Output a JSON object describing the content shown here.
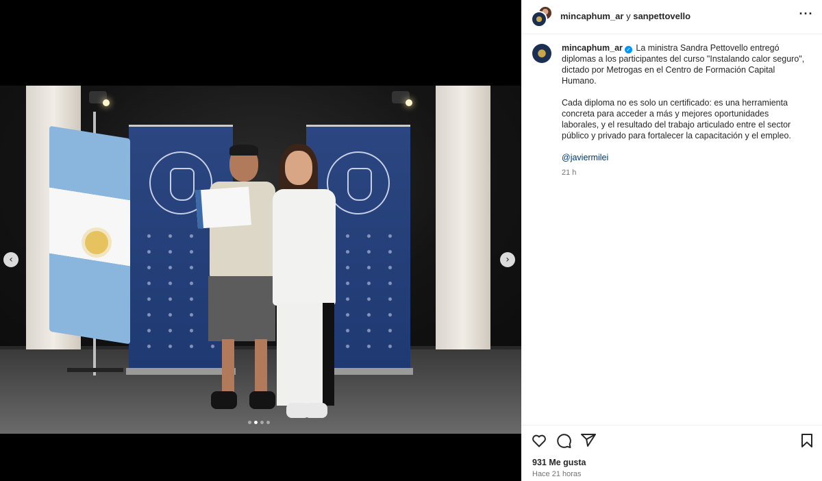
{
  "header": {
    "user1": "mincaphum_ar",
    "joiner": " y ",
    "user2": "sanpettovello",
    "more_icon": "more-horizontal-icon"
  },
  "caption": {
    "username": "mincaphum_ar",
    "verified_icon": "verified-badge-icon",
    "paragraph1": "La ministra Sandra Pettovello entregó diplomas a los participantes del curso \"Instalando calor seguro\", dictado por Metrogas en el Centro de Formación Capital Humano.",
    "paragraph2": "Cada diploma no es solo un certificado: es una herramienta concreta para acceder a más y mejores oportunidades laborales, y el resultado del trabajo articulado entre el sector público y privado para fortalecer la capacitación y el empleo.",
    "mention": "@javiermilei",
    "time": "21 h"
  },
  "carousel": {
    "prev_icon": "chevron-left-icon",
    "next_icon": "chevron-right-icon",
    "slide_count": 4,
    "active_index": 1
  },
  "actions": {
    "like_icon": "heart-icon",
    "comment_icon": "comment-icon",
    "share_icon": "send-icon",
    "save_icon": "bookmark-icon"
  },
  "stats": {
    "likes": "931 Me gusta",
    "posted": "Hace 21 horas"
  },
  "colors": {
    "link": "#00376b",
    "verified": "#0095f6",
    "muted": "#737373"
  }
}
